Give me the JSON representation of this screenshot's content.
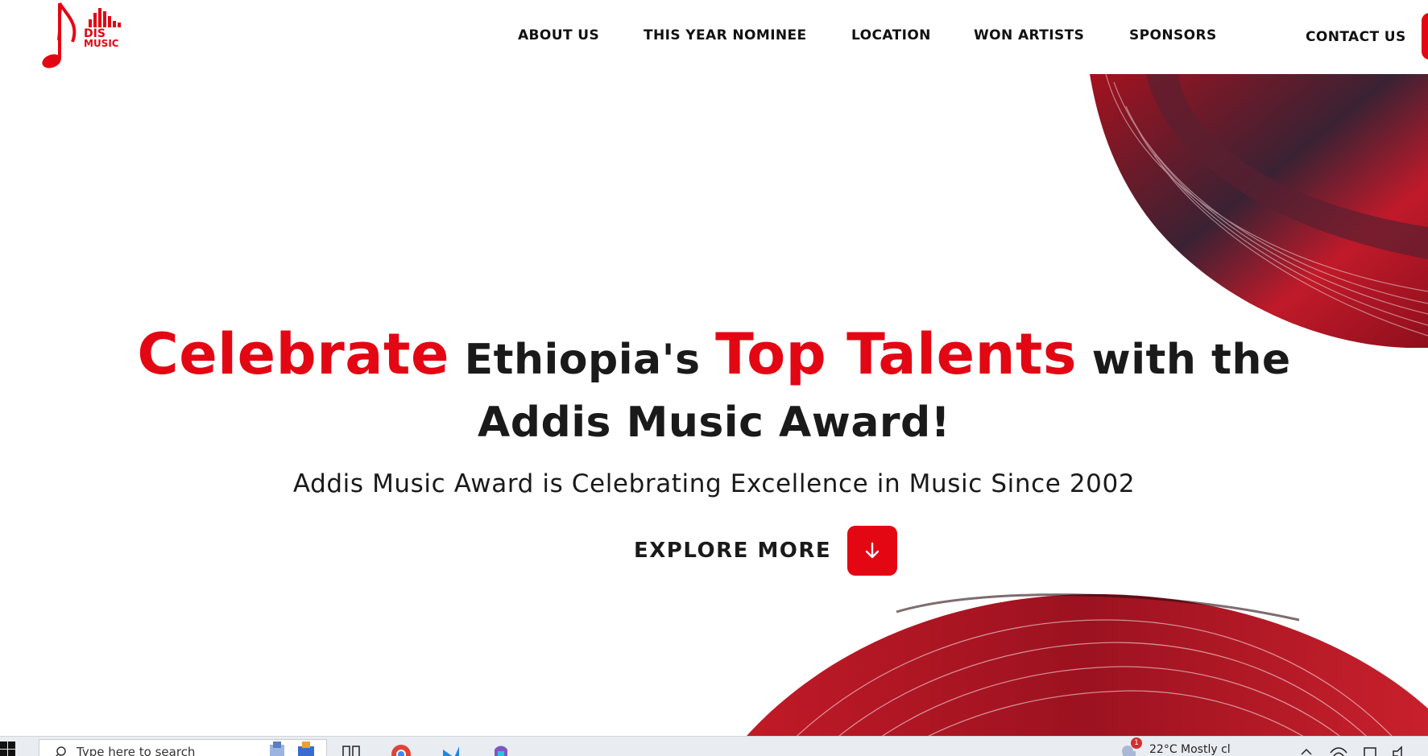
{
  "logo": {
    "line1": "DIS",
    "line2": "MUSIC",
    "color": "#e30613"
  },
  "nav": {
    "items": [
      {
        "label": "ABOUT US"
      },
      {
        "label": "THIS YEAR NOMINEE"
      },
      {
        "label": "LOCATION"
      },
      {
        "label": "WON ARTISTS"
      },
      {
        "label": "SPONSORS"
      }
    ],
    "contact_label": "CONTACT US"
  },
  "hero": {
    "title_part1": "Celebrate",
    "title_part2": "Ethiopia's",
    "title_part3": "Top Talents",
    "title_part4": "with the",
    "title_line2": "Addis Music Award!",
    "subtitle": "Addis Music Award is Celebrating Excellence in Music Since 2002",
    "explore_label": "EXPLORE MORE"
  },
  "colors": {
    "accent": "#e30613",
    "text": "#1a1a1a"
  },
  "taskbar": {
    "search_placeholder": "Type here to search",
    "weather_text": "22°C  Mostly cl",
    "notification_count": "1",
    "icons": [
      "windows-start-icon",
      "search-icon",
      "task-view-icon",
      "chrome-icon",
      "vscode-icon",
      "copilot-icon",
      "weather-icon",
      "network-icon",
      "volume-icon"
    ]
  }
}
